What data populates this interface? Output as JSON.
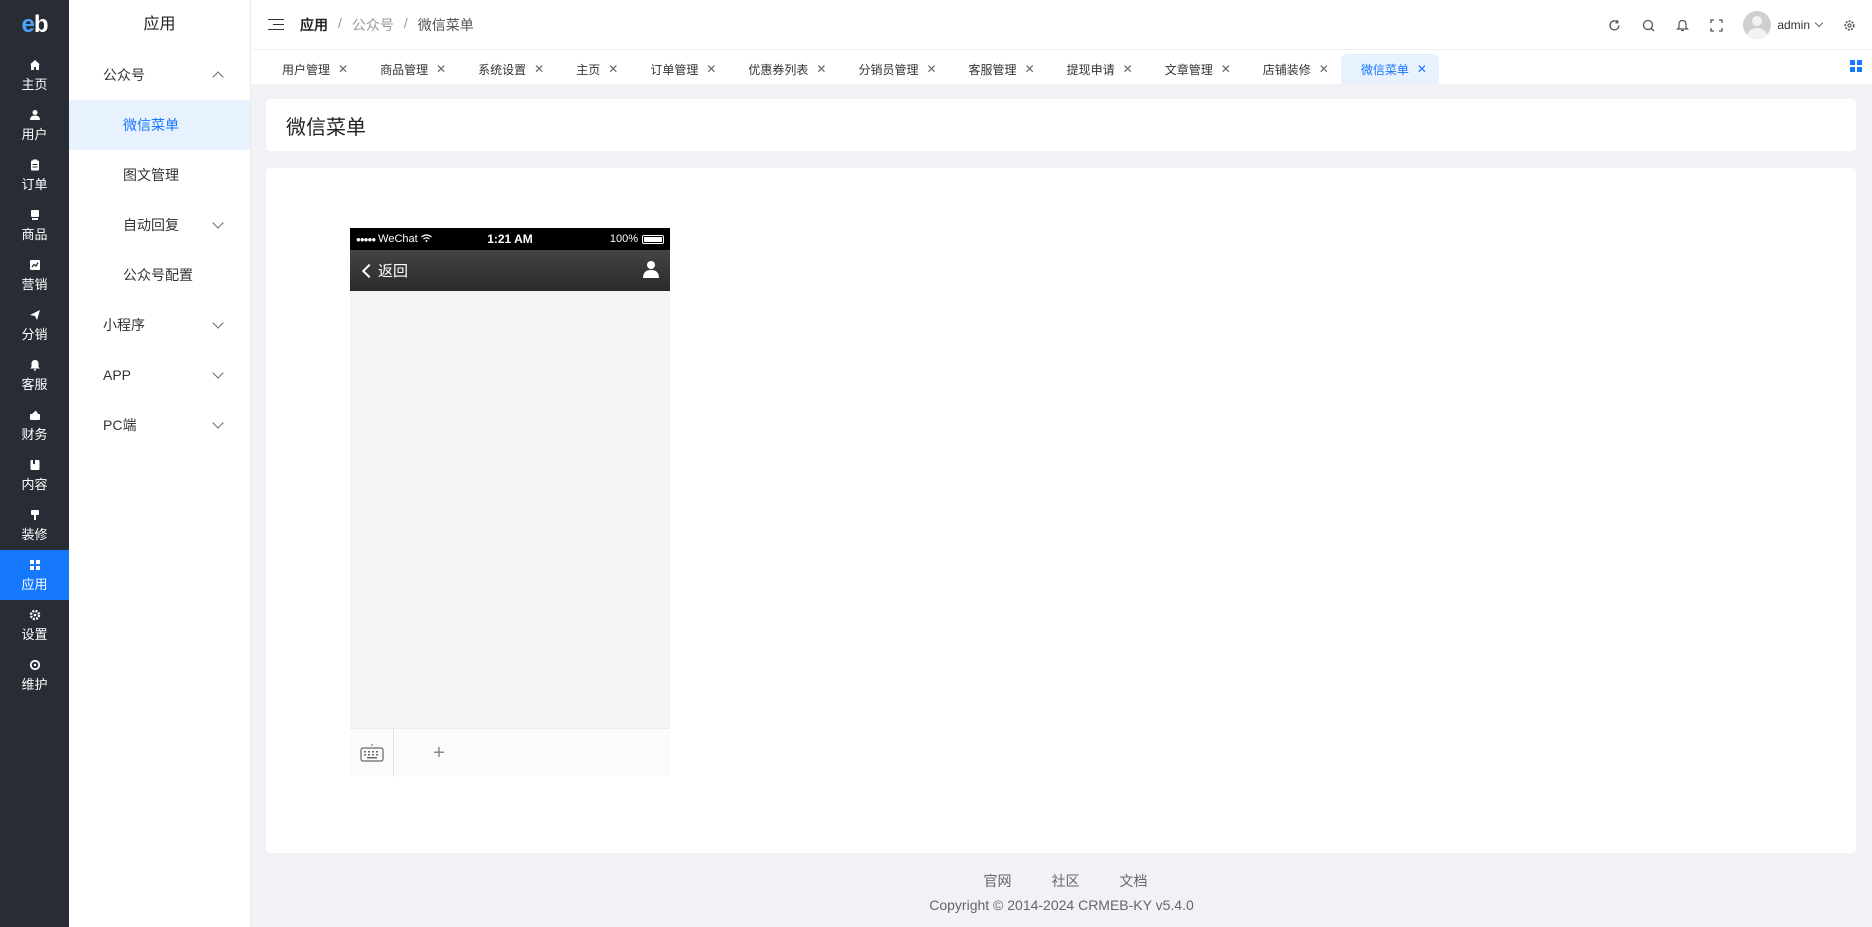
{
  "rail": {
    "logo": "eb",
    "items": [
      {
        "label": "主页",
        "icon": "home-icon"
      },
      {
        "label": "用户",
        "icon": "user-icon"
      },
      {
        "label": "订单",
        "icon": "order-icon"
      },
      {
        "label": "商品",
        "icon": "product-icon"
      },
      {
        "label": "营销",
        "icon": "marketing-icon"
      },
      {
        "label": "分销",
        "icon": "send-icon"
      },
      {
        "label": "客服",
        "icon": "bell-icon"
      },
      {
        "label": "财务",
        "icon": "finance-icon"
      },
      {
        "label": "内容",
        "icon": "content-icon"
      },
      {
        "label": "装修",
        "icon": "decorate-icon"
      },
      {
        "label": "应用",
        "icon": "grid-icon"
      },
      {
        "label": "设置",
        "icon": "gear-icon"
      },
      {
        "label": "维护",
        "icon": "maintain-icon"
      }
    ]
  },
  "subnav": {
    "title": "应用",
    "group1": "公众号",
    "sub1": "微信菜单",
    "sub2": "图文管理",
    "sub3": "自动回复",
    "sub4": "公众号配置",
    "group2": "小程序",
    "group3": "APP",
    "group4": "PC端"
  },
  "header": {
    "crumb1": "应用",
    "crumb2": "公众号",
    "crumb3": "微信菜单",
    "sep": "/",
    "username": "admin"
  },
  "tabs": [
    {
      "label": "用户管理"
    },
    {
      "label": "商品管理"
    },
    {
      "label": "系统设置"
    },
    {
      "label": "主页"
    },
    {
      "label": "订单管理"
    },
    {
      "label": "优惠券列表"
    },
    {
      "label": "分销员管理"
    },
    {
      "label": "客服管理"
    },
    {
      "label": "提现申请"
    },
    {
      "label": "文章管理"
    },
    {
      "label": "店铺装修"
    },
    {
      "label": "微信菜单"
    }
  ],
  "page": {
    "title": "微信菜单"
  },
  "phone": {
    "carrier": "WeChat",
    "time": "1:21 AM",
    "battery": "100%",
    "back": "返回",
    "plus": "+"
  },
  "footer": {
    "link1": "官网",
    "link2": "社区",
    "link3": "文档",
    "copyright": "Copyright © 2014-2024 CRMEB-KY v5.4.0"
  },
  "colors": {
    "accent": "#1677ff",
    "rail_bg": "#282c34"
  }
}
